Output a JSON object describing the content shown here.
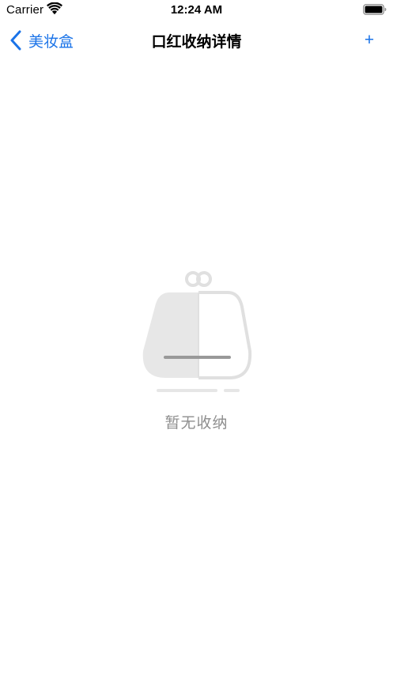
{
  "status_bar": {
    "carrier": "Carrier",
    "time": "12:24 AM",
    "wifi_icon": "wifi-icon",
    "battery_icon": "battery-icon"
  },
  "nav_bar": {
    "back_label": "美妆盒",
    "title": "口红收纳详情",
    "add_label": "+",
    "back_icon": "chevron-left-icon",
    "accent_color": "#1a73e8"
  },
  "empty_state": {
    "message": "暂无收纳",
    "icon": "empty-purse-icon",
    "text_color": "#8e8e8e"
  }
}
